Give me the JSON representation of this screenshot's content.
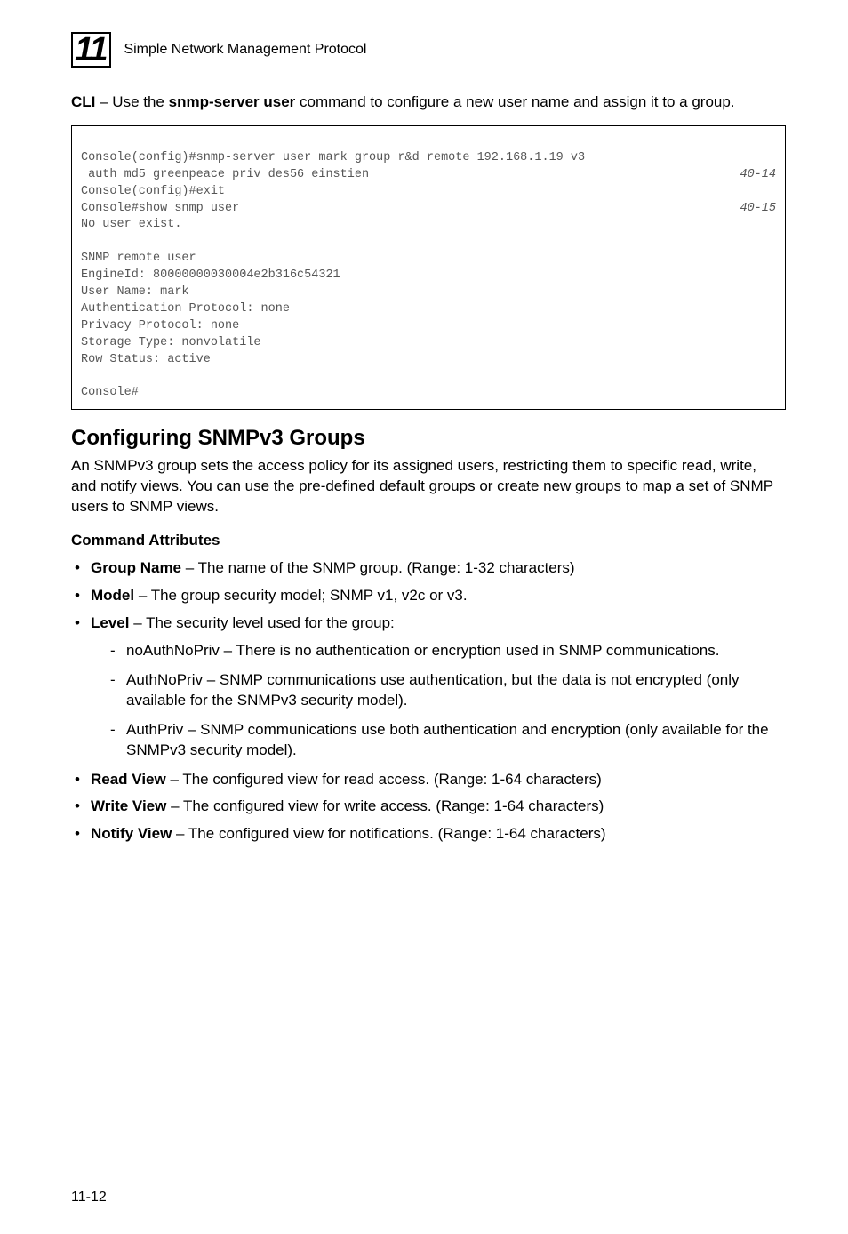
{
  "header": {
    "chapter": "11",
    "title": "Simple Network Management Protocol"
  },
  "intro": {
    "prefix": "CLI",
    "separator": " – Use the ",
    "command": "snmp-server user",
    "suffix": " command to configure a new user name and assign it to a group."
  },
  "code": {
    "line1": "Console(config)#snmp-server user mark group r&d remote 192.168.1.19 v3",
    "line2_text": " auth md5 greenpeace priv des56 einstien",
    "line2_ref": "40-14",
    "line3": "Console(config)#exit",
    "line4_text": "Console#show snmp user",
    "line4_ref": "40-15",
    "line5": "No user exist.",
    "blank": "",
    "line6": "SNMP remote user",
    "line7": "EngineId: 80000000030004e2b316c54321",
    "line8": "User Name: mark",
    "line9": "Authentication Protocol: none",
    "line10": "Privacy Protocol: none",
    "line11": "Storage Type: nonvolatile",
    "line12": "Row Status: active",
    "line13": "Console#"
  },
  "section": {
    "heading": "Configuring SNMPv3 Groups",
    "para": "An SNMPv3 group sets the access policy for its assigned users, restricting them to specific read, write, and notify views. You can use the pre-defined default groups or create new groups to map a set of SNMP users to SNMP views.",
    "subheading": "Command Attributes"
  },
  "bullets": {
    "b1_label": "Group Name",
    "b1_text": " – The name of the SNMP group. (Range: 1-32 characters)",
    "b2_label": "Model",
    "b2_text": " – The group security model; SNMP v1, v2c or v3.",
    "b3_label": "Level",
    "b3_text": " – The security level used for the group:",
    "b3_sub1": "noAuthNoPriv – There is no authentication or encryption used in SNMP communications.",
    "b3_sub2": "AuthNoPriv – SNMP communications use authentication, but the data is not encrypted (only available for the SNMPv3 security model).",
    "b3_sub3": "AuthPriv – SNMP communications use both authentication and encryption (only available for the SNMPv3 security model).",
    "b4_label": "Read View",
    "b4_text": " – The configured view for read access. (Range: 1-64 characters)",
    "b5_label": "Write View",
    "b5_text": " – The configured view for write access. (Range: 1-64 characters)",
    "b6_label": "Notify View",
    "b6_text": " – The configured view for notifications. (Range: 1-64 characters)"
  },
  "footer": {
    "pagenum": "11-12"
  }
}
